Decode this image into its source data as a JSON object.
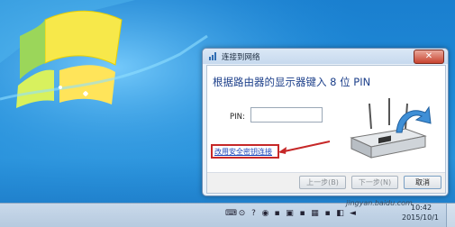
{
  "desktop": {
    "background": "#1f8bd8"
  },
  "dialog": {
    "title": "连接到网络",
    "close_label": "✕",
    "heading": "根据路由器的显示器键入 8 位 PIN",
    "pin_label": "PIN:",
    "pin_value": "",
    "security_link": "改用安全密钥连接",
    "buttons": {
      "prev": "上一步(B)",
      "next": "下一步(N)",
      "cancel": "取消"
    }
  },
  "taskbar": {
    "tray_icons": [
      "keyboard-icon",
      "language-icon",
      "help-icon",
      "network-icon",
      "volume-icon",
      "app-icon",
      "app-icon",
      "app-icon",
      "app-icon",
      "app-icon",
      "app-icon"
    ],
    "time": "10:42",
    "date": "2015/10/1"
  },
  "watermark": "jingyan.baidu.com",
  "colors": {
    "link": "#1a44b8",
    "highlight": "#c62828",
    "heading": "#1c3f8a"
  }
}
